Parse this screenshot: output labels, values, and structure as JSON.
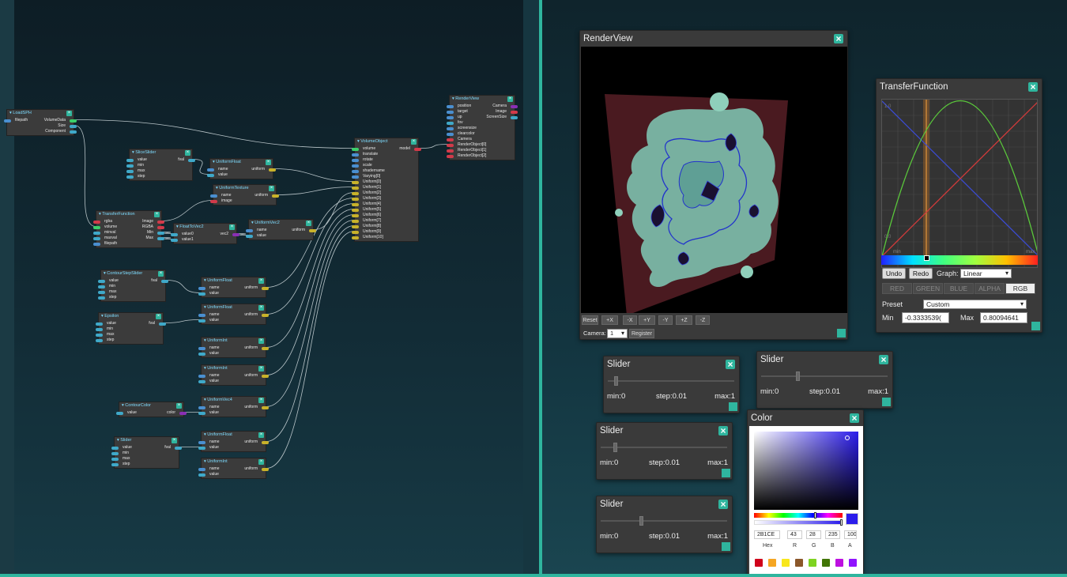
{
  "nodes": [
    {
      "id": "loadsph",
      "title": "▾ LoadSPH",
      "inputs": [
        "filepath"
      ],
      "outputs": [
        "VolumeData",
        "Size",
        "Component"
      ]
    },
    {
      "id": "renderview_node",
      "title": "▾ RenderView",
      "inputs": [
        "position",
        "target",
        "up",
        "fov",
        "screensize",
        "clearcolor",
        "Camera",
        "RenderObject[0]",
        "RenderObject[1]",
        "RenderObject[2]"
      ],
      "outputs": [
        "Camera",
        "Image",
        "ScreenSize"
      ]
    },
    {
      "id": "volumeobject",
      "title": "▾ VolumeObject",
      "inputs": [
        "volume",
        "translate",
        "rotate",
        "scale",
        "shadername",
        "Varying[0]",
        "Uniform[0]",
        "Uniform[1]",
        "Uniform[2]",
        "Uniform[3]",
        "Uniform[4]",
        "Uniform[5]",
        "Uniform[6]",
        "Uniform[7]",
        "Uniform[8]",
        "Uniform[9]",
        "Uniform[10]"
      ],
      "outputs": [
        "model"
      ]
    },
    {
      "id": "sliceslider",
      "title": "▾ SliceSlider",
      "inputs": [
        "value",
        "min",
        "max",
        "step"
      ],
      "outputs": [
        "fval"
      ]
    },
    {
      "id": "uniformfloat1",
      "title": "▾ UniformFloat",
      "inputs": [
        "name",
        "value"
      ],
      "outputs": [
        "uniform"
      ]
    },
    {
      "id": "uniformtexture",
      "title": "▾ UniformTexture",
      "inputs": [
        "name",
        "image"
      ],
      "outputs": [
        "uniform"
      ]
    },
    {
      "id": "transferfunction_node",
      "title": "▾ TransferFunction",
      "inputs": [
        "rgba",
        "volume",
        "minval",
        "maxval",
        "filepath"
      ],
      "outputs": [
        "Image",
        "RGBA",
        "Min",
        "Max"
      ]
    },
    {
      "id": "floattovec2",
      "title": "▾ FloatToVec2",
      "inputs": [
        "value0",
        "value1"
      ],
      "outputs": [
        "vec2"
      ]
    },
    {
      "id": "uniformvec2",
      "title": "▾ UniformVec2",
      "inputs": [
        "name",
        "value"
      ],
      "outputs": [
        "uniform"
      ]
    },
    {
      "id": "contourstepslider",
      "title": "▾ ContourStepSlider",
      "inputs": [
        "value",
        "min",
        "max",
        "step"
      ],
      "outputs": [
        "fval"
      ]
    },
    {
      "id": "uniformfloat2",
      "title": "▾ UniformFloat",
      "inputs": [
        "name",
        "value"
      ],
      "outputs": [
        "uniform"
      ]
    },
    {
      "id": "epsilon",
      "title": "▾ Epsilon",
      "inputs": [
        "value",
        "min",
        "max",
        "step"
      ],
      "outputs": [
        "fval"
      ]
    },
    {
      "id": "uniformfloat3",
      "title": "▾ UniformFloat",
      "inputs": [
        "name",
        "value"
      ],
      "outputs": [
        "uniform"
      ]
    },
    {
      "id": "uniformint1",
      "title": "▾ UniformInt",
      "inputs": [
        "name",
        "value"
      ],
      "outputs": [
        "uniform"
      ]
    },
    {
      "id": "uniformint2",
      "title": "▾ UniformInt",
      "inputs": [
        "name",
        "value"
      ],
      "outputs": [
        "uniform"
      ]
    },
    {
      "id": "contourcolor",
      "title": "▾ ContourColor",
      "inputs": [
        "value"
      ],
      "outputs": [
        "color"
      ]
    },
    {
      "id": "uniformvec4",
      "title": "▾ UniformVec4",
      "inputs": [
        "name",
        "value"
      ],
      "outputs": [
        "uniform"
      ]
    },
    {
      "id": "slider_node",
      "title": "▾ Slider",
      "inputs": [
        "value",
        "min",
        "max",
        "step"
      ],
      "outputs": [
        "fval"
      ]
    },
    {
      "id": "uniformfloat4",
      "title": "▾ UniformFloat",
      "inputs": [
        "name",
        "value"
      ],
      "outputs": [
        "uniform"
      ]
    },
    {
      "id": "uniformint3",
      "title": "▾ UniformInt",
      "inputs": [
        "name",
        "value"
      ],
      "outputs": [
        "uniform"
      ]
    }
  ],
  "renderview": {
    "title": "RenderView",
    "buttons": [
      "Reset",
      "+X",
      "-X",
      "+Y",
      "-Y",
      "+Z",
      "-Z"
    ],
    "camera_label": "Camera:",
    "camera_value": "1",
    "register_label": "Register"
  },
  "transferfunction": {
    "title": "TransferFunction",
    "axis_top": "1.0",
    "axis_bottom": "0.0",
    "axis_min": "min",
    "axis_max": "max",
    "undo": "Undo",
    "redo": "Redo",
    "graph_label": "Graph:",
    "graph_value": "Linear",
    "tabs": [
      "RED",
      "GREEN",
      "BLUE",
      "ALPHA",
      "RGB"
    ],
    "active_tab": "RGB",
    "preset_label": "Preset",
    "preset_value": "Custom",
    "min_label": "Min",
    "min_value": "-0.3333539(",
    "max_label": "Max",
    "max_value": "0.80094641"
  },
  "sliders": [
    {
      "title": "Slider",
      "min": "min:0",
      "step": "step:0.01",
      "max": "max:1",
      "level": 0.05
    },
    {
      "title": "Slider",
      "min": "min:0",
      "step": "step:0.01",
      "max": "max:1",
      "level": 0.28
    },
    {
      "title": "Slider",
      "min": "min:0",
      "step": "step:0.01",
      "max": "max:1",
      "level": 0.1
    },
    {
      "title": "Slider",
      "min": "min:0",
      "step": "step:0.01",
      "max": "max:1",
      "level": 0.31
    }
  ],
  "color": {
    "title": "Color",
    "hex": "2B1CE",
    "r": "43",
    "g": "28",
    "b": "235",
    "a": "100",
    "labels": [
      "Hex",
      "R",
      "G",
      "B",
      "A"
    ],
    "current": "#2b1ceb",
    "swatches": [
      "#d0021b",
      "#f5a623",
      "#f8e71c",
      "#8b572a",
      "#7ed321",
      "#417505",
      "#bd10e0",
      "#9013fe"
    ]
  },
  "colors": {
    "accent": "#2fb59e",
    "port_float": "#3fa9c9",
    "port_uniform": "#c8b22a",
    "port_vec": "#8a2fb5",
    "port_image": "#d23a4a"
  }
}
